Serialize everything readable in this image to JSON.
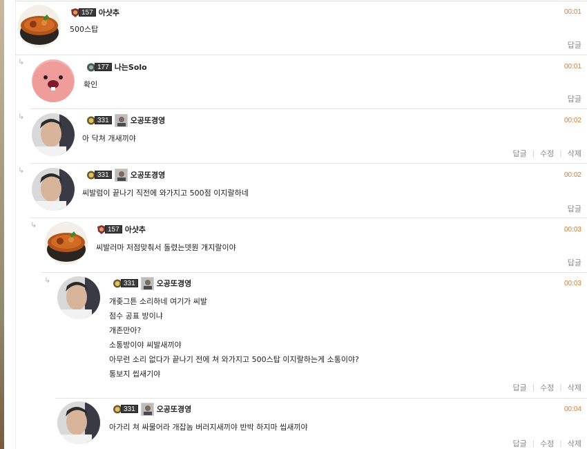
{
  "comments": [
    {
      "level": "157",
      "nick": "아샷추",
      "time": "00:01",
      "lines": [
        "500스탑"
      ],
      "actions": [
        "답글"
      ]
    },
    {
      "level": "177",
      "nick": "나는Solo",
      "time": "00:01",
      "lines": [
        "확인"
      ],
      "actions": [
        "답글"
      ]
    },
    {
      "level": "331",
      "nick": "오공또경영",
      "time": "00:02",
      "lines": [
        "아 닥쳐 개새끼야"
      ],
      "actions": [
        "답글",
        "수정",
        "삭제"
      ]
    },
    {
      "level": "331",
      "nick": "오공또경영",
      "time": "00:02",
      "lines": [
        "씨발럼이 끝나기 직전에 와가지고 500점 이지랄하네"
      ],
      "actions": [
        "답글"
      ]
    },
    {
      "level": "157",
      "nick": "아샷추",
      "time": "00:03",
      "lines": [
        "씨발러마 저점맞춰서 돌렸는뎃뭔 개지랄이야"
      ],
      "actions": [
        "답글"
      ]
    },
    {
      "level": "331",
      "nick": "오공또경영",
      "time": "00:03",
      "lines": [
        "개좆그튼 소리하네 여기가 씨발",
        "점수 공표 방이냐",
        "개존만아?",
        "소통방이야 씨발새끼야",
        "아무런 소리 없다가 끝나기 전에 쳐 와가지고 500스탑 이지랄하는게 소통이야?",
        "통보지 씹새기야"
      ],
      "actions": [
        "답글",
        "수정",
        "삭제"
      ]
    },
    {
      "level": "331",
      "nick": "오공또경영",
      "time": "00:04",
      "lines": [
        "아가리 쳐  싸물어라 개잡놈 버러지새끼야 반박 하지마 씹새끼야"
      ],
      "actions": [
        "답글",
        "수정",
        "삭제"
      ]
    }
  ],
  "icons": {
    "reply_arrow": "reply-arrow-icon",
    "avatar_food": "food-bowl-avatar",
    "avatar_pink": "pink-creature-avatar",
    "avatar_person": "person-photo-avatar"
  },
  "colors": {
    "time": "#e07b22",
    "action": "#888888",
    "divider": "#e4e4e4"
  }
}
